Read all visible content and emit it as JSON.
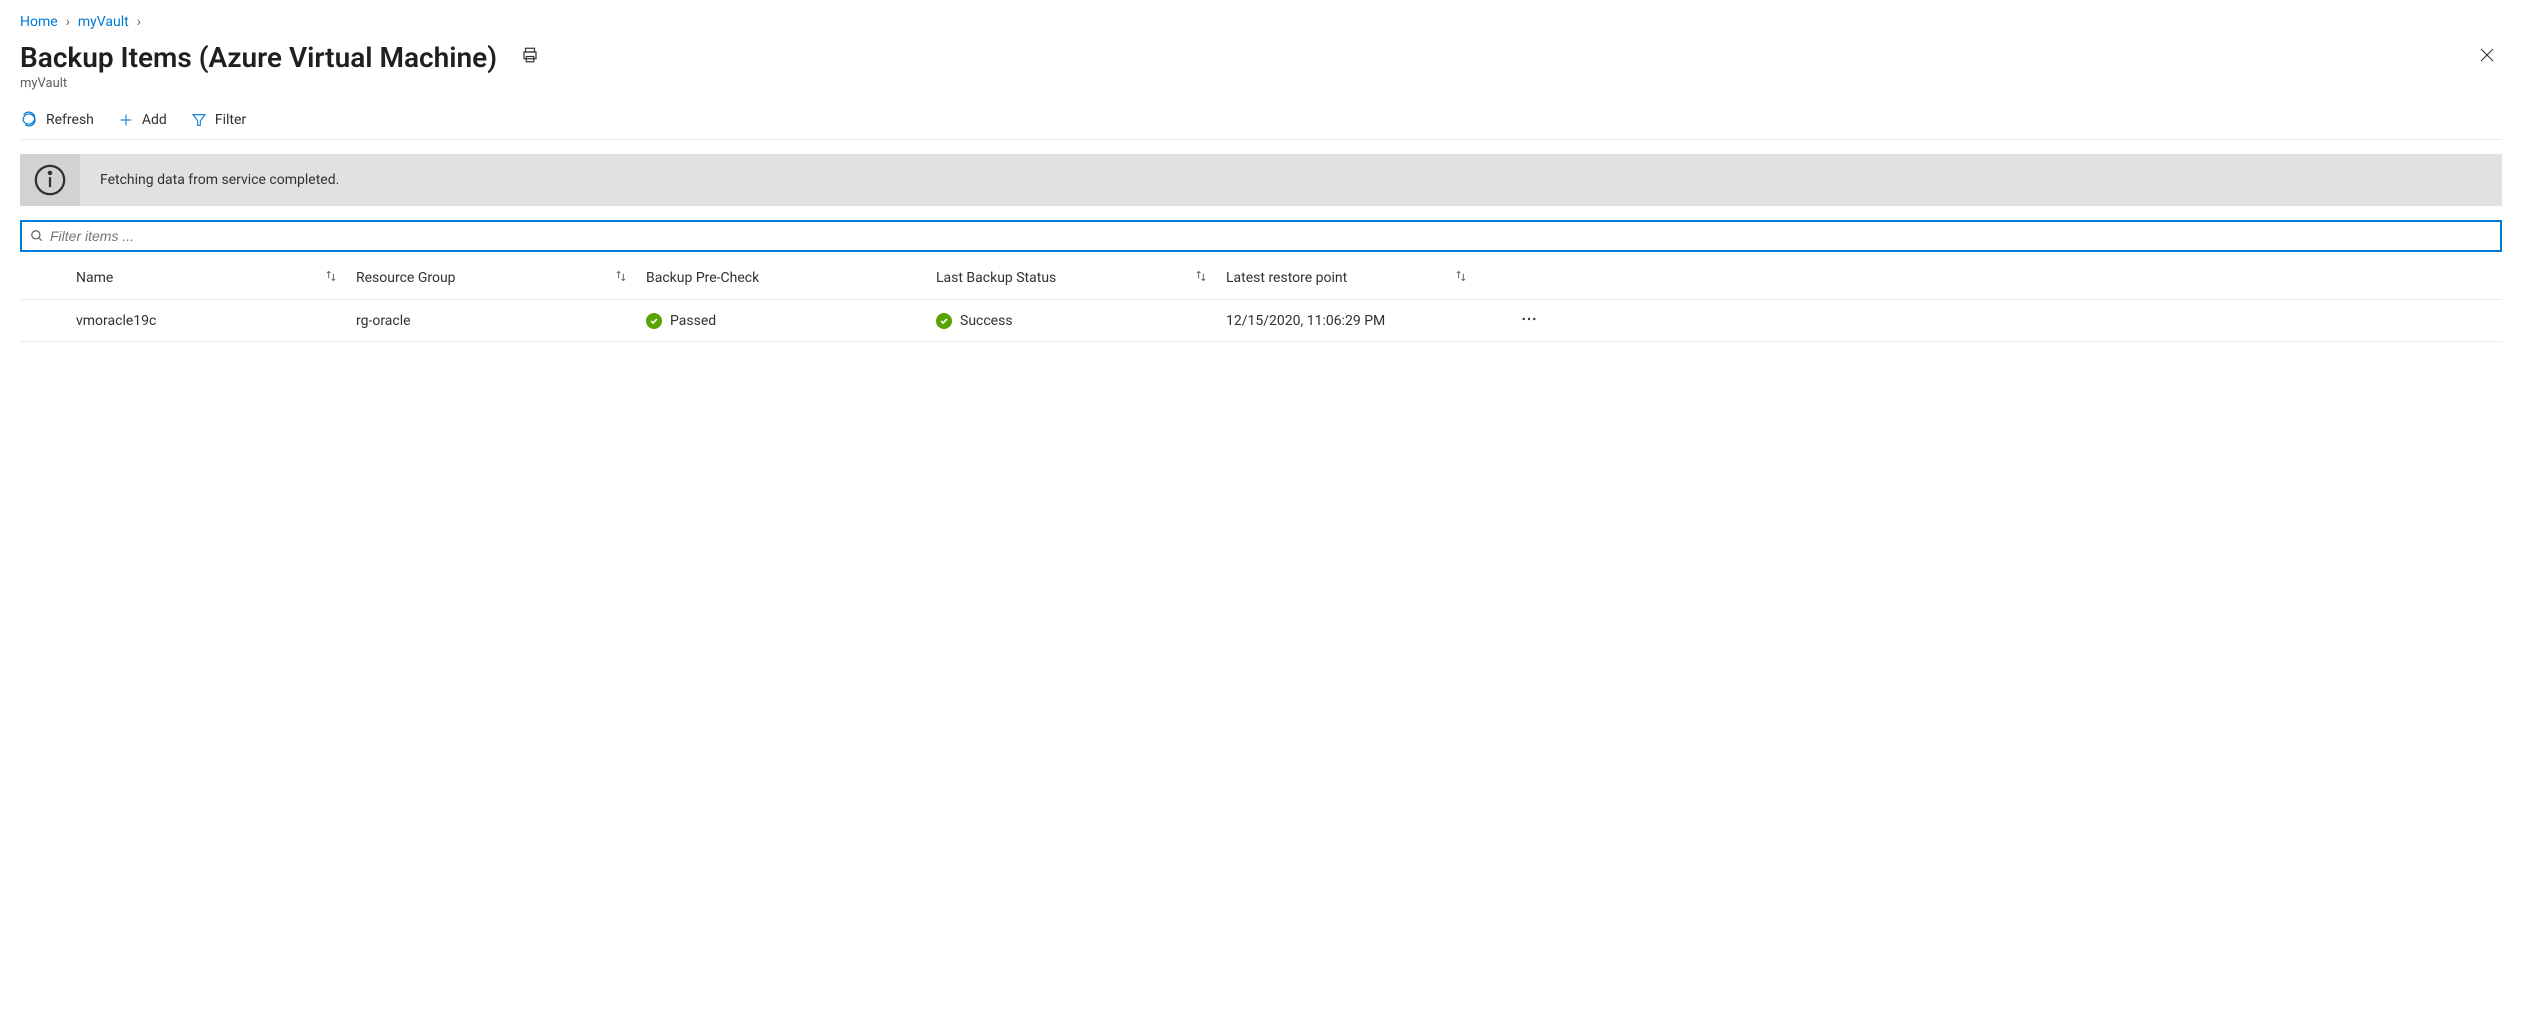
{
  "breadcrumb": {
    "home": "Home",
    "vault": "myVault"
  },
  "title": "Backup Items (Azure Virtual Machine)",
  "subtitle": "myVault",
  "toolbar": {
    "refresh": "Refresh",
    "add": "Add",
    "filter": "Filter"
  },
  "banner": {
    "message": "Fetching data from service completed."
  },
  "filter": {
    "placeholder": "Filter items ..."
  },
  "columns": {
    "name": "Name",
    "resource_group": "Resource Group",
    "pre_check": "Backup Pre-Check",
    "last_status": "Last Backup Status",
    "restore_point": "Latest restore point"
  },
  "rows": [
    {
      "name": "vmoracle19c",
      "resource_group": "rg-oracle",
      "pre_check": "Passed",
      "last_status": "Success",
      "restore_point": "12/15/2020, 11:06:29 PM"
    }
  ]
}
